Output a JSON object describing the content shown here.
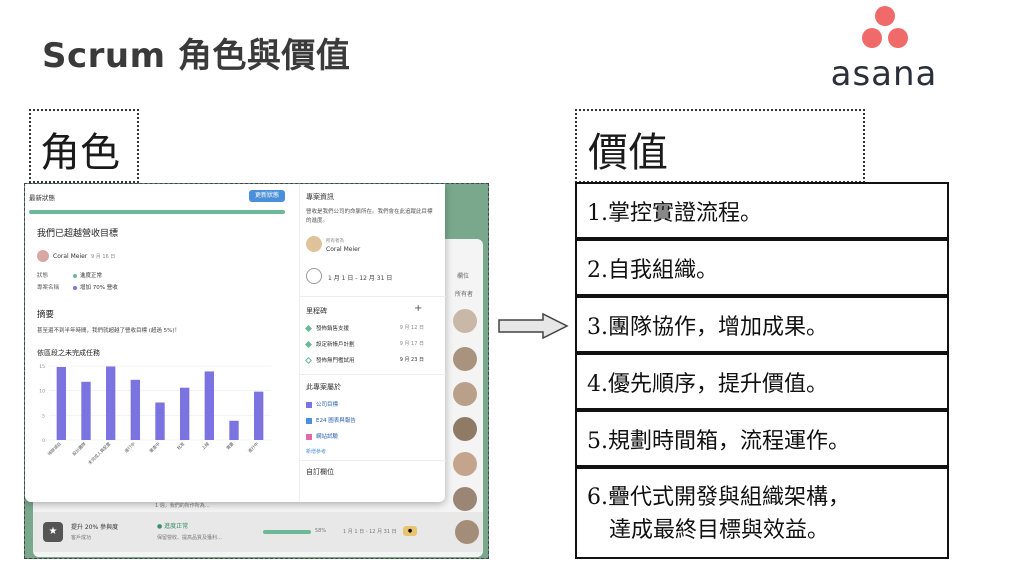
{
  "slide": {
    "title": "Scrum 角色與價值",
    "roles_label": "角色",
    "values_label": "價值"
  },
  "logo": {
    "text": "asana",
    "dot_color": "#f06a6a"
  },
  "screenshot": {
    "status": {
      "title": "最新狀態",
      "update_button": "更新狀態",
      "goal_title": "我們已超越營收目標",
      "author": "Coral Meier",
      "date": "9 月 16 日",
      "status_key": "狀態",
      "status_value": "進度正常",
      "project_key": "專案名稱",
      "project_value": "增加 70% 營收",
      "summary_title": "摘要",
      "summary_text": "甚至還不到半年時間，我們就超越了營收目標 (超過 5%)！",
      "chart_title": "依區段之未完成任務"
    },
    "chart_data": {
      "type": "bar",
      "title": "依區段之未完成任務",
      "categories": [
        "待辦項目",
        "設計團隊",
        "未完成人員配置",
        "進行中",
        "審查中",
        "批准",
        "上線",
        "需要",
        "進行中"
      ],
      "values": [
        14.8,
        11.8,
        14.9,
        12.2,
        7.6,
        10.6,
        13.9,
        3.9,
        9.8
      ],
      "yticks": [
        "15",
        "10",
        "5",
        "0"
      ],
      "ylim": [
        0,
        15
      ],
      "bar_color": "#7b74e0"
    },
    "project": {
      "title": "專案資訊",
      "text": "營收是我們公司的命脈所在。我們會在此追蹤此目標的進度。",
      "owner_label": "所有者為",
      "owner": "Coral Meier",
      "date_range": "1 月 1 日 - 12 月 31 日",
      "milestones_title": "里程碑",
      "add_symbol": "+",
      "milestones": [
        {
          "label": "發佈銷售支援",
          "date": "9 月 12 日"
        },
        {
          "label": "設定新帳戶計劃",
          "date": "9 月 17 日"
        },
        {
          "label": "發佈無門檻試用",
          "date": "9 月 23 日"
        }
      ],
      "resources_title": "此專案屬於",
      "resources": [
        "公司目標",
        "E24 圖表與報告",
        "網站試驗"
      ],
      "add_link": "新增參考",
      "custom_title": "自訂欄位"
    },
    "background": {
      "column_label": "所有者",
      "field_label": "欄位",
      "bottom_name": "提升 20% 參與度",
      "bottom_sub": "客戶成功",
      "bottom_status": "● 進度正常",
      "bottom_status_sub": "保留營收、提高品質及獲利…",
      "bottom_percent": "58%",
      "bottom_dates": "1 月 1 日 - 12 月 31 日",
      "faded_text": "1 週，我們的所作所為…"
    }
  },
  "values": [
    {
      "text": "1.掌控實證流程。"
    },
    {
      "text": "2.自我組織。"
    },
    {
      "text": "3.團隊協作，增加成果。"
    },
    {
      "text": "4.優先順序，提升價值。"
    },
    {
      "text": "5.規劃時間箱，流程運作。"
    },
    {
      "text": "6.疊代式開發與組織架構，",
      "text2": "　達成最終目標與效益。"
    }
  ]
}
